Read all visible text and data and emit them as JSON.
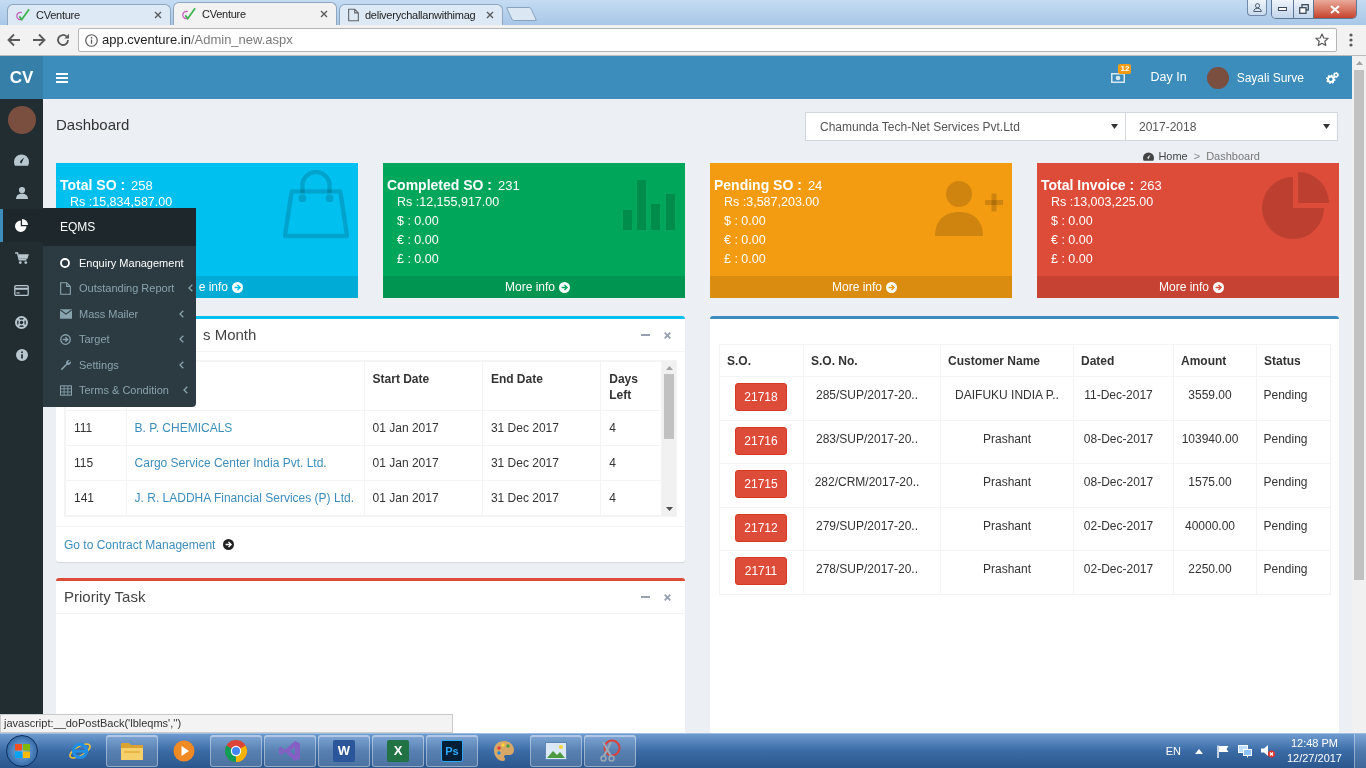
{
  "browser": {
    "tabs": [
      {
        "title": "CVenture",
        "kind": "site",
        "selected": false
      },
      {
        "title": "CVenture",
        "kind": "site",
        "selected": true
      },
      {
        "title": "deliverychallanwithimag",
        "kind": "document",
        "selected": false
      }
    ],
    "address": {
      "host": "app.cventure.in",
      "path": "/Admin_new.aspx"
    }
  },
  "header": {
    "logo": "CV",
    "notification_count": "12",
    "day_in": "Day In",
    "user_name": "Sayali Surve"
  },
  "sidebar": {
    "items": [
      {
        "kind": "dashboard",
        "selected": false
      },
      {
        "kind": "user",
        "selected": false
      },
      {
        "kind": "pie",
        "selected": true
      },
      {
        "kind": "cart",
        "selected": false
      },
      {
        "kind": "card",
        "selected": false
      },
      {
        "kind": "ring",
        "selected": false
      },
      {
        "kind": "info",
        "selected": false
      }
    ]
  },
  "flyout": {
    "title": "EQMS",
    "items": [
      {
        "label": "Enquiry Management",
        "kind": "circle",
        "selected": true,
        "submenu": false
      },
      {
        "label": "Outstanding Report",
        "kind": "file",
        "selected": false,
        "submenu": true
      },
      {
        "label": "Mass Mailer",
        "kind": "envelope",
        "selected": false,
        "submenu": true
      },
      {
        "label": "Target",
        "kind": "arrow",
        "selected": false,
        "submenu": true
      },
      {
        "label": "Settings",
        "kind": "wrench",
        "selected": false,
        "submenu": true
      },
      {
        "label": "Terms & Condition",
        "kind": "table",
        "selected": false,
        "submenu": true
      }
    ]
  },
  "page": {
    "title": "Dashboard",
    "company": "Chamunda Tech-Net Services Pvt.Ltd",
    "year": "2017-2018",
    "breadcrumb": {
      "items": [
        "Home",
        "Dashboard"
      ],
      "separator": ">"
    }
  },
  "stat_cards": [
    {
      "label": "Total SO :",
      "count": "258",
      "color": "#00c0ef",
      "kind": "bag",
      "lines": [
        "Rs :15,834,587.00"
      ],
      "more": "e info"
    },
    {
      "label": "Completed SO :",
      "count": "231",
      "color": "#00a65a",
      "kind": "bars",
      "lines": [
        "Rs :12,155,917.00",
        "$ : 0.00",
        "€ : 0.00",
        "£ : 0.00"
      ],
      "more": "More info"
    },
    {
      "label": "Pending SO :",
      "count": "24",
      "color": "#f39c12",
      "kind": "user_plus",
      "lines": [
        "Rs :3,587,203.00",
        "$ : 0.00",
        "€ : 0.00",
        "£ : 0.00"
      ],
      "more": "More info"
    },
    {
      "label": "Total Invoice :",
      "count": "263",
      "color": "#dd4b39",
      "kind": "pie",
      "lines": [
        "Rs :13,003,225.00",
        "$ : 0.00",
        "€ : 0.00",
        "£ : 0.00"
      ],
      "more": "More info"
    }
  ],
  "contracts": {
    "title": "s Month",
    "columns": [
      "",
      "",
      "Start Date",
      "End Date",
      "Days Left"
    ],
    "rows": [
      [
        "111",
        "B. P. CHEMICALS",
        "01 Jan 2017",
        "31 Dec 2017",
        "4"
      ],
      [
        "115",
        "Cargo Service Center India Pvt. Ltd.",
        "01 Jan 2017",
        "31 Dec 2017",
        "4"
      ],
      [
        "141",
        "J. R. LADDHA Financial Services (P) Ltd.",
        "01 Jan 2017",
        "31 Dec 2017",
        "4"
      ]
    ],
    "link": "Go to Contract Management"
  },
  "priority_task": {
    "title": "Priority Task"
  },
  "orders": {
    "columns": [
      "S.O.",
      "S.O. No.",
      "Customer Name",
      "Dated",
      "Amount",
      "Status"
    ],
    "rows": [
      {
        "so": "21718",
        "so_no": "285/SUP/2017-20..",
        "customer": "DAIFUKU INDIA P..",
        "dated": "11-Dec-2017",
        "amount": "3559.00",
        "status": "Pending"
      },
      {
        "so": "21716",
        "so_no": "283/SUP/2017-20..",
        "customer": "Prashant",
        "dated": "08-Dec-2017",
        "amount": "103940.00",
        "status": "Pending"
      },
      {
        "so": "21715",
        "so_no": "282/CRM/2017-20..",
        "customer": "Prashant",
        "dated": "08-Dec-2017",
        "amount": "1575.00",
        "status": "Pending"
      },
      {
        "so": "21712",
        "so_no": "279/SUP/2017-20..",
        "customer": "Prashant",
        "dated": "02-Dec-2017",
        "amount": "40000.00",
        "status": "Pending"
      },
      {
        "so": "21711",
        "so_no": "278/SUP/2017-20..",
        "customer": "Prashant",
        "dated": "02-Dec-2017",
        "amount": "2250.00",
        "status": "Pending"
      }
    ]
  },
  "status_url": "javascript:__doPostBack('lbleqms','')",
  "taskbar": {
    "apps": [
      {
        "kind": "ie",
        "running": false
      },
      {
        "kind": "folder",
        "running": true
      },
      {
        "kind": "media",
        "running": false
      },
      {
        "kind": "chrome",
        "running": true
      },
      {
        "kind": "vs",
        "running": true
      },
      {
        "kind": "word",
        "label": "W",
        "running": true
      },
      {
        "kind": "excel",
        "label": "X",
        "running": true
      },
      {
        "kind": "photoshop",
        "label": "Ps",
        "running": true
      },
      {
        "kind": "paint",
        "running": false
      },
      {
        "kind": "photos",
        "running": true
      },
      {
        "kind": "snipping",
        "running": true
      }
    ],
    "language": "EN",
    "time": "12:48 PM",
    "date": "12/27/2017"
  }
}
